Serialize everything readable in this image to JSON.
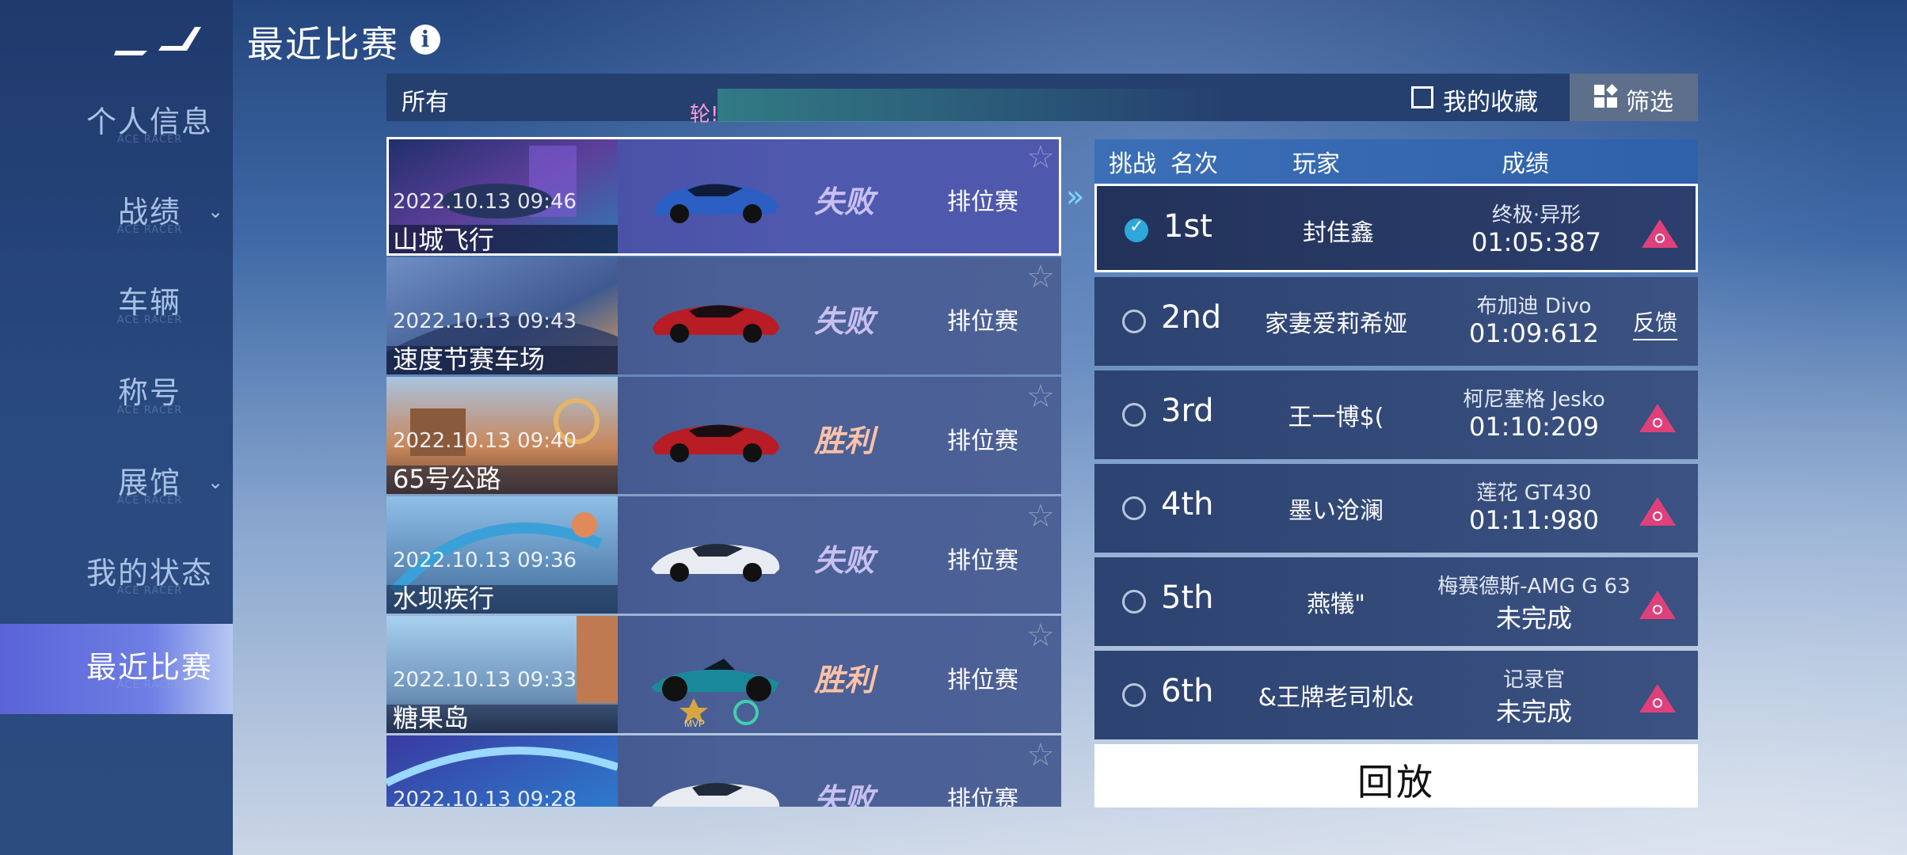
{
  "sidebar": {
    "brand_sub": "ACE RACER",
    "items": [
      {
        "label": "个人信息",
        "has_chevron": false,
        "active": false
      },
      {
        "label": "战绩",
        "has_chevron": true,
        "active": false
      },
      {
        "label": "车辆",
        "has_chevron": false,
        "active": false
      },
      {
        "label": "称号",
        "has_chevron": false,
        "active": false
      },
      {
        "label": "展馆",
        "has_chevron": true,
        "active": false
      },
      {
        "label": "我的状态",
        "has_chevron": false,
        "active": false
      },
      {
        "label": "最近比赛",
        "has_chevron": false,
        "active": true
      }
    ]
  },
  "header": {
    "title": "最近比赛",
    "info_icon": "i"
  },
  "filter": {
    "all_label": "所有",
    "ticker_text": "轮!",
    "favorites_label": "我的收藏",
    "favorites_checked": false,
    "screen_label": "筛选"
  },
  "races": [
    {
      "date": "2022.10.13 09:46",
      "track": "山城飞行",
      "result": "失败",
      "result_type": "lose",
      "mode": "排位赛",
      "car": "blue-hypercar",
      "selected": true
    },
    {
      "date": "2022.10.13 09:43",
      "track": "速度节赛车场",
      "result": "失败",
      "result_type": "lose",
      "mode": "排位赛",
      "car": "red-sedan",
      "selected": false
    },
    {
      "date": "2022.10.13 09:40",
      "track": "65号公路",
      "result": "胜利",
      "result_type": "win",
      "mode": "排位赛",
      "car": "red-sedan",
      "selected": false
    },
    {
      "date": "2022.10.13 09:36",
      "track": "水坝疾行",
      "result": "失败",
      "result_type": "lose",
      "mode": "排位赛",
      "car": "white-hypercar",
      "selected": false
    },
    {
      "date": "2022.10.13 09:33",
      "track": "糖果岛",
      "result": "胜利",
      "result_type": "win",
      "mode": "排位赛",
      "car": "teal-open-wheel",
      "selected": false,
      "badges": [
        "MVP"
      ]
    },
    {
      "date": "2022.10.13 09:28",
      "track": "",
      "result": "失败",
      "result_type": "lose",
      "mode": "排位赛",
      "car": "white-hypercar",
      "selected": false
    }
  ],
  "leaderboard": {
    "headers": {
      "challenge": "挑战",
      "rank": "名次",
      "player": "玩家",
      "score": "成绩"
    },
    "rows": [
      {
        "rank": "1st",
        "player": "封佳鑫",
        "car": "终极·异形",
        "time": "01:05:387",
        "checked": true,
        "action": "report-icon"
      },
      {
        "rank": "2nd",
        "player": "家妻爱莉希娅",
        "car": "布加迪 Divo",
        "time": "01:09:612",
        "checked": false,
        "action": "feedback",
        "action_label": "反馈"
      },
      {
        "rank": "3rd",
        "player": "王一博$(",
        "car": "柯尼塞格 Jesko",
        "time": "01:10:209",
        "checked": false,
        "action": "report-icon"
      },
      {
        "rank": "4th",
        "player": "墨い沧澜",
        "car": "莲花 GT430",
        "time": "01:11:980",
        "checked": false,
        "action": "report-icon"
      },
      {
        "rank": "5th",
        "player": "燕犠\"",
        "car": "梅赛德斯-AMG G 63",
        "time": "未完成",
        "checked": false,
        "action": "report-icon"
      },
      {
        "rank": "6th",
        "player": "&王牌老司机&",
        "car": "记录官",
        "time": "未完成",
        "checked": false,
        "action": "report-icon"
      }
    ]
  },
  "replay_label": "回放",
  "colors": {
    "accent": "#5a64d8",
    "lose": "#c8c0f2",
    "win": "#ffc2a8",
    "report": "#e0407a",
    "check": "#2ea7da"
  }
}
